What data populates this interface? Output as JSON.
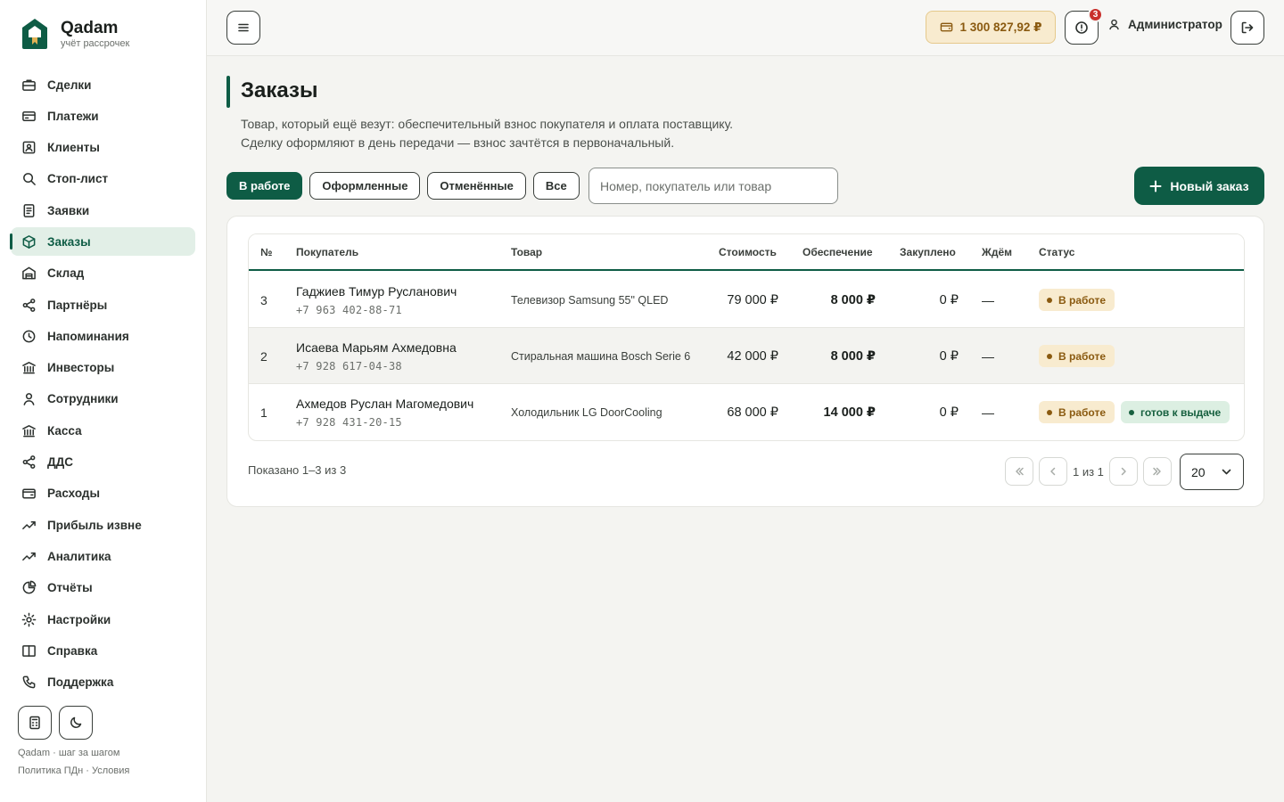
{
  "brand": {
    "name": "Qadam",
    "tagline": "учёт рассрочек"
  },
  "sidebar": {
    "items": [
      {
        "label": "Сделки",
        "icon": "briefcase-icon"
      },
      {
        "label": "Платежи",
        "icon": "credit-card-icon"
      },
      {
        "label": "Клиенты",
        "icon": "contact-card-icon"
      },
      {
        "label": "Стоп-лист",
        "icon": "search-icon"
      },
      {
        "label": "Заявки",
        "icon": "document-icon"
      },
      {
        "label": "Заказы",
        "icon": "box-icon",
        "active": true
      },
      {
        "label": "Склад",
        "icon": "warehouse-icon"
      },
      {
        "label": "Партнёры",
        "icon": "share-icon"
      },
      {
        "label": "Напоминания",
        "icon": "clock-icon"
      },
      {
        "label": "Инвесторы",
        "icon": "bank-icon"
      },
      {
        "label": "Сотрудники",
        "icon": "user-icon"
      },
      {
        "label": "Касса",
        "icon": "bank-icon"
      },
      {
        "label": "ДДС",
        "icon": "share-icon"
      },
      {
        "label": "Расходы",
        "icon": "wallet-icon"
      },
      {
        "label": "Прибыль извне",
        "icon": "trend-up-icon"
      },
      {
        "label": "Аналитика",
        "icon": "trend-up-icon"
      },
      {
        "label": "Отчёты",
        "icon": "pie-chart-icon"
      },
      {
        "label": "Настройки",
        "icon": "gear-icon"
      },
      {
        "label": "Справка",
        "icon": "book-icon"
      },
      {
        "label": "Поддержка",
        "icon": "phone-icon"
      }
    ],
    "footer_line1": "Qadam · шаг за шагом",
    "footer_line2": "Политика ПДн · Условия"
  },
  "topbar": {
    "balance": "1 300 827,92 ₽",
    "alerts_count": "3",
    "user_name": "Администратор"
  },
  "page": {
    "title": "Заказы",
    "subtitle_line1": "Товар, который ещё везут: обеспечительный взнос покупателя и оплата поставщику.",
    "subtitle_line2": "Сделку оформляют в день передачи — взнос зачтётся в первоначальный."
  },
  "filters": {
    "tabs": [
      "В работе",
      "Оформленные",
      "Отменённые",
      "Все"
    ],
    "active_tab": "В работе",
    "search_placeholder": "Номер, покупатель или товар",
    "new_order_label": "Новый заказ"
  },
  "table": {
    "headers": [
      "№",
      "Покупатель",
      "Товар",
      "Стоимость",
      "Обеспечение",
      "Закуплено",
      "Ждём",
      "Статус"
    ],
    "rows": [
      {
        "num": "3",
        "buyer": "Гаджиев Тимур Русланович",
        "phone": "+7 963 402-88-71",
        "goods": "Телевизор Samsung 55\" QLED",
        "cost": "79 000 ₽",
        "security": "8 000 ₽",
        "bought": "0 ₽",
        "waiting": "—",
        "status": "В работе",
        "extra_status": ""
      },
      {
        "num": "2",
        "buyer": "Исаева Марьям Ахмедовна",
        "phone": "+7 928 617-04-38",
        "goods": "Стиральная машина Bosch Serie 6",
        "cost": "42 000 ₽",
        "security": "8 000 ₽",
        "bought": "0 ₽",
        "waiting": "—",
        "status": "В работе",
        "extra_status": ""
      },
      {
        "num": "1",
        "buyer": "Ахмедов Руслан Магомедович",
        "phone": "+7 928 431-20-15",
        "goods": "Холодильник LG DoorCooling",
        "cost": "68 000 ₽",
        "security": "14 000 ₽",
        "bought": "0 ₽",
        "waiting": "—",
        "status": "В работе",
        "extra_status": "готов к выдаче"
      }
    ]
  },
  "pagination": {
    "shown": "Показано 1–3 из 3",
    "page_info": "1 из 1",
    "page_size": "20"
  },
  "colors": {
    "accent": "#0e5c45",
    "warning_bg": "#f8ebcf",
    "warning_text": "#8a5a10",
    "success_bg": "#dcefe2",
    "success_text": "#17603f",
    "badge": "#c9302c"
  }
}
